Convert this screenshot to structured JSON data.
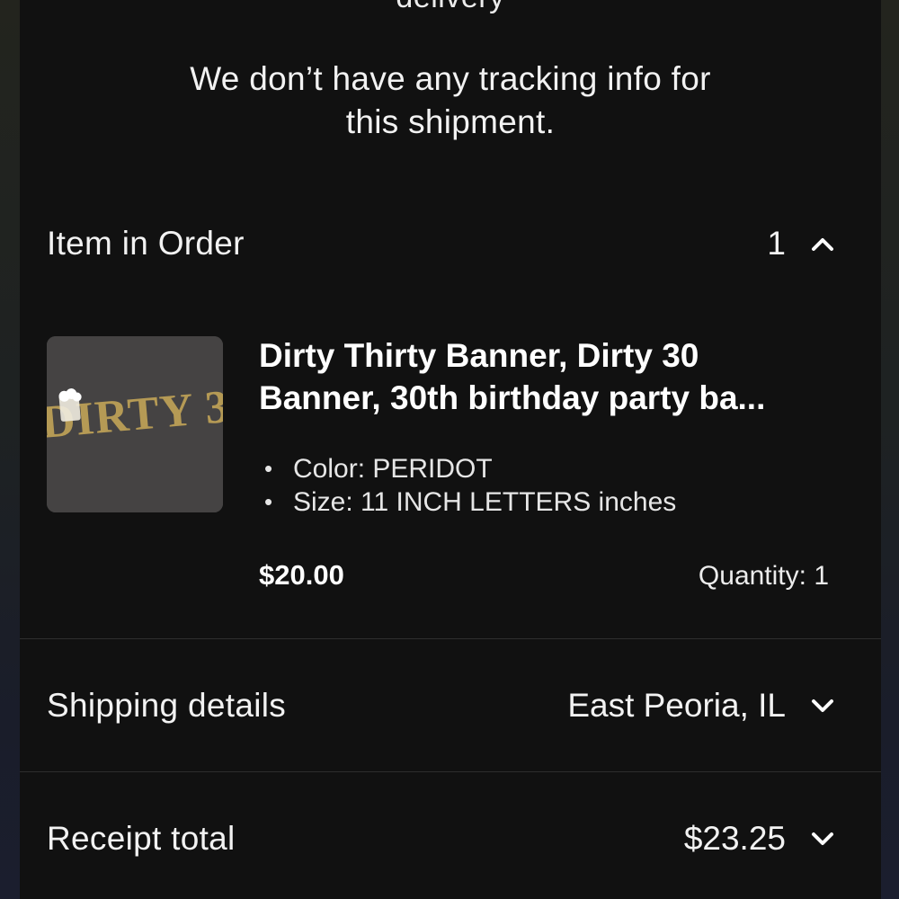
{
  "top": {
    "cut_text": "delivery"
  },
  "tracking": {
    "line1": "We don’t have any tracking info for",
    "line2": "this shipment."
  },
  "items_section": {
    "title": "Item in Order",
    "count": "1",
    "expanded": true
  },
  "product": {
    "thumbnail_text": "DIRTY 3",
    "title_line1": "Dirty Thirty Banner, Dirty 30",
    "title_line2": "Banner, 30th birthday party ba...",
    "variations": [
      {
        "bullet": "•",
        "text": "Color: PERIDOT"
      },
      {
        "bullet": "•",
        "text": "Size: 11 INCH LETTERS inches"
      }
    ],
    "price": "$20.00",
    "quantity_label": "Quantity: 1"
  },
  "shipping": {
    "title": "Shipping details",
    "value": "East Peoria, IL"
  },
  "receipt": {
    "title": "Receipt total",
    "value": "$23.25"
  },
  "colors": {
    "sheet_bg": "#111111",
    "text": "#f2f2f2",
    "divider": "#2e2e2e",
    "thumb_bg": "#4a4848",
    "glitter_gold": "#b59a55"
  }
}
